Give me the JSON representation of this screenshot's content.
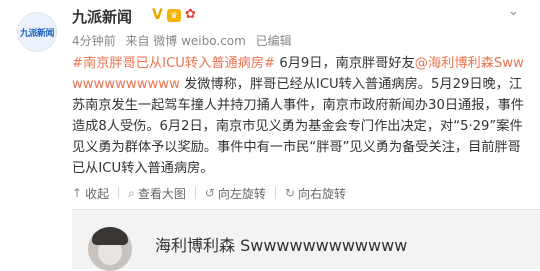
{
  "author": {
    "name": "九派新闻",
    "avatar_text": "九派新闻",
    "verify_badge": "V"
  },
  "meta": {
    "time": "4分钟前",
    "source": "来自 微博 weibo.com",
    "edited": "已编辑"
  },
  "post": {
    "topic": "#南京胖哥已从ICU转入普通病房#",
    "text_before_mention": "6月9日，南京胖哥好友",
    "mention": "@海利博利森Swwwwwwwwwwww",
    "text_after_mention": "发微博称，胖哥已经从ICU转入普通病房。5月29日晚，江苏南京发生一起驾车撞人并持刀捅人事件，南京市政府新闻办30日通报，事件造成8人受伤。6月2日，南京市见义勇为基金会专门作出决定，对“5·29”案件见义勇为群体予以奖励。事件中有一市民“胖哥”见义勇为备受关注，目前胖哥已从ICU转入普通病房。"
  },
  "actions": [
    {
      "icon": "↑",
      "label": "收起"
    },
    {
      "icon": "⌕",
      "label": "查看大图"
    },
    {
      "icon": "↺",
      "label": "向左旋转"
    },
    {
      "icon": "↻",
      "label": "向右旋转"
    }
  ],
  "quote": {
    "name": "海利博利森 Swwwwwwwwwwww"
  }
}
